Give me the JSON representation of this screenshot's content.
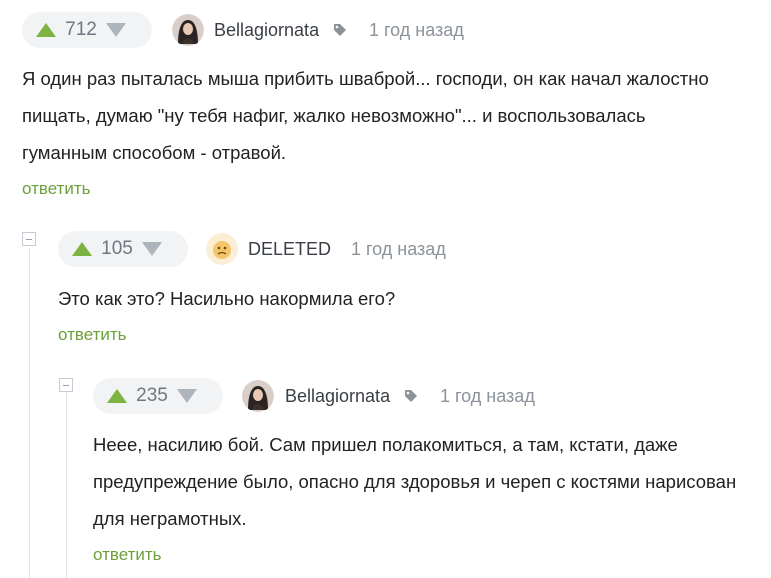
{
  "comments": [
    {
      "rating": "712",
      "author": "Bellagiornata",
      "time": "1 год назад",
      "text": "Я один раз пыталась мыша прибить шваброй... господи, он как начал жалостно пищать, думаю \"ну тебя нафиг, жалко невозможно\"... и воспользовалась гуманным способом - отравой.",
      "reply_label": "ответить",
      "avatar": "user-photo-avatar"
    },
    {
      "rating": "105",
      "author": "DELETED",
      "time": "1 год назад",
      "text": "Это как это? Насильно накормила его?",
      "reply_label": "ответить",
      "avatar": "deleted-user-avatar"
    },
    {
      "rating": "235",
      "author": "Bellagiornata",
      "time": "1 год назад",
      "text": "Неее, насилию бой. Сам пришел полакомиться, а там, кстати, даже предупреждение было, опасно для здоровья и череп с костями нарисован для неграмотных.",
      "reply_label": "ответить",
      "avatar": "user-photo-avatar"
    }
  ],
  "icons": {
    "upvote": "arrow-up-icon",
    "downvote": "arrow-down-icon",
    "tag": "tag-icon",
    "collapse": "collapse-icon"
  },
  "colors": {
    "upvote": "#7cb342",
    "downvote": "#aeb4bc",
    "reply": "#6ca03a",
    "vote_bg": "#f2f3f5"
  }
}
